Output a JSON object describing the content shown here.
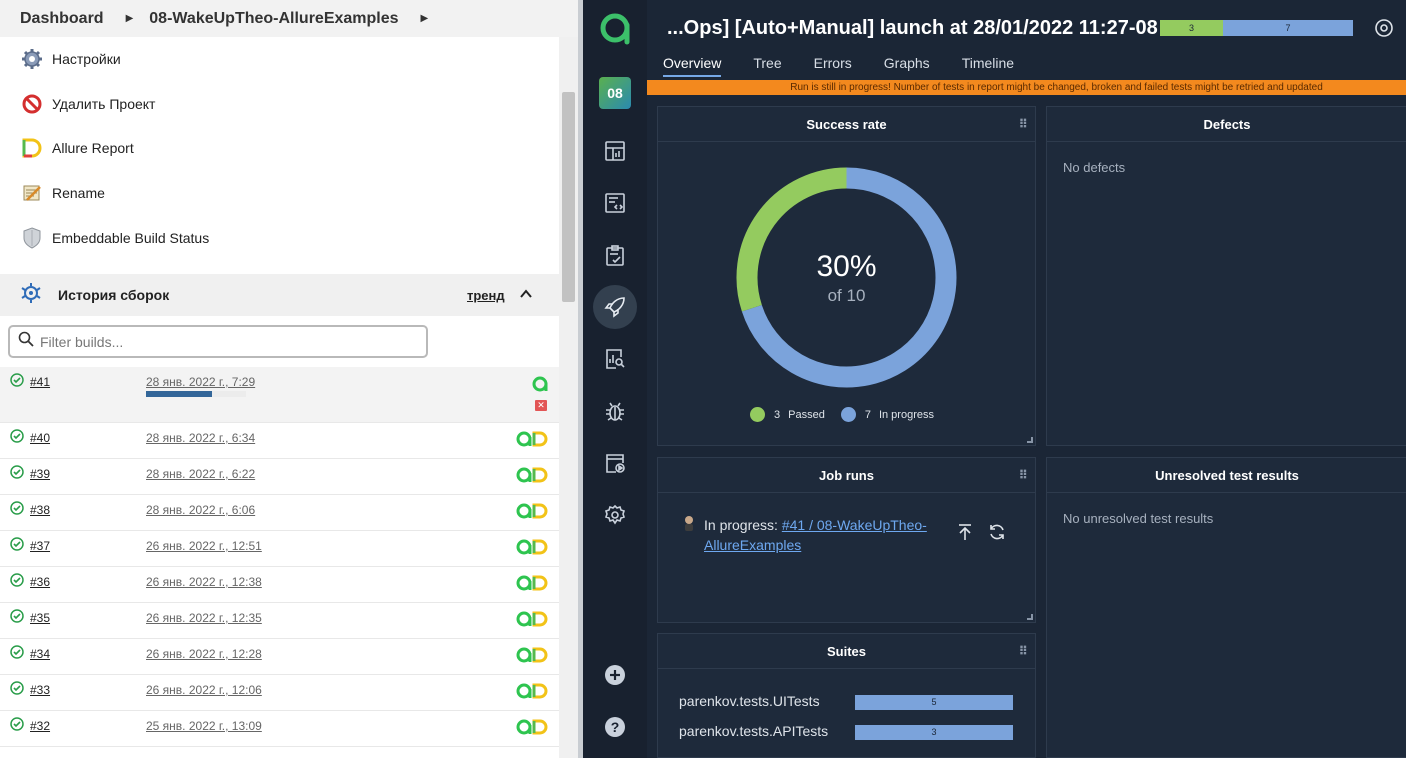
{
  "jenkins": {
    "breadcrumb": [
      "Dashboard",
      "08-WakeUpTheo-AllureExamples"
    ],
    "menu": [
      {
        "label": "Настройки",
        "icon": "gear-icon"
      },
      {
        "label": "Удалить Проект",
        "icon": "no-entry-icon"
      },
      {
        "label": "Allure Report",
        "icon": "allure-report-icon"
      },
      {
        "label": "Rename",
        "icon": "notepad-icon"
      },
      {
        "label": "Embeddable Build Status",
        "icon": "shield-icon"
      }
    ],
    "history": {
      "title": "История сборок",
      "trend": "тренд",
      "filter_placeholder": "Filter builds..."
    },
    "builds": [
      {
        "num": "#41",
        "date": "28 янв. 2022 г., 7:29",
        "progress": 0.66,
        "running": true
      },
      {
        "num": "#40",
        "date": "28 янв. 2022 г., 6:34"
      },
      {
        "num": "#39",
        "date": "28 янв. 2022 г., 6:22"
      },
      {
        "num": "#38",
        "date": "28 янв. 2022 г., 6:06"
      },
      {
        "num": "#37",
        "date": "26 янв. 2022 г., 12:51"
      },
      {
        "num": "#36",
        "date": "26 янв. 2022 г., 12:38"
      },
      {
        "num": "#35",
        "date": "26 янв. 2022 г., 12:35"
      },
      {
        "num": "#34",
        "date": "26 янв. 2022 г., 12:28"
      },
      {
        "num": "#33",
        "date": "26 янв. 2022 г., 12:06"
      },
      {
        "num": "#32",
        "date": "25 янв. 2022 г., 13:09"
      }
    ]
  },
  "allure": {
    "project_badge": "08",
    "launch_title": "...Ops] [Auto+Manual] launch at 28/01/2022 11:27-08",
    "stat_bar": {
      "passed": "3",
      "in_progress": "7"
    },
    "tabs": [
      "Overview",
      "Tree",
      "Errors",
      "Graphs",
      "Timeline"
    ],
    "warning": "Run is still in progress! Number of tests in report might be changed, broken and failed tests might be retried and updated",
    "success_rate": {
      "title": "Success rate",
      "percent": "30%",
      "of": "of 10",
      "legend": [
        {
          "count": "3",
          "label": "Passed",
          "color": "#94cb5f"
        },
        {
          "count": "7",
          "label": "In progress",
          "color": "#7ba3db"
        }
      ]
    },
    "defects": {
      "title": "Defects",
      "empty": "No defects"
    },
    "job_runs": {
      "title": "Job runs",
      "status": "In progress:",
      "link": "#41 / 08-WakeUpTheo-AllureExamples"
    },
    "unresolved": {
      "title": "Unresolved test results",
      "empty": "No unresolved test results"
    },
    "suites": {
      "title": "Suites",
      "rows": [
        {
          "name": "parenkov.tests.UITests",
          "count": "5"
        },
        {
          "name": "parenkov.tests.APITests",
          "count": "3"
        }
      ]
    },
    "colors": {
      "passed": "#94cb5f",
      "in_progress": "#7ba3db",
      "warning": "#f3891e",
      "background": "#1b2636"
    }
  }
}
